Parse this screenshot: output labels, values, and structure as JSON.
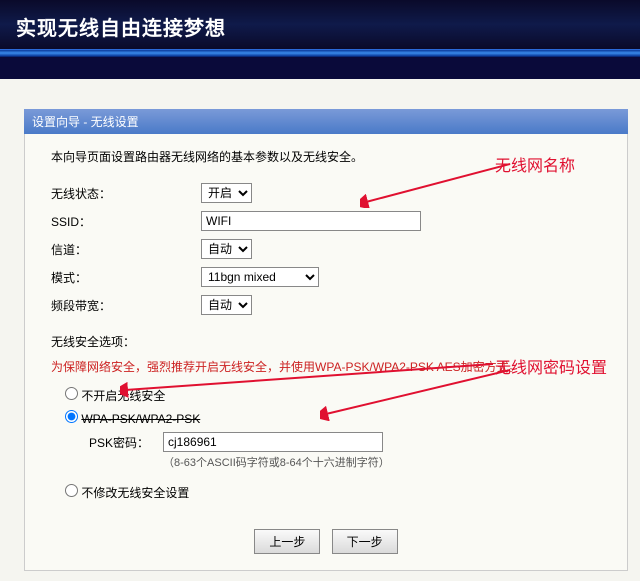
{
  "header": {
    "title": "实现无线自由连接梦想"
  },
  "panel": {
    "title": "设置向导 - 无线设置",
    "instruction": "本向导页面设置路由器无线网络的基本参数以及无线安全。",
    "labels": {
      "wireless_state": "无线状态：",
      "ssid": "SSID：",
      "channel": "信道：",
      "mode": "模式：",
      "bandwidth": "频段带宽：",
      "security_header": "无线安全选项：",
      "security_tip": "为保障网络安全，强烈推荐开启无线安全，并使用WPA-PSK/WPA2-PSK AES加密方式。",
      "psk_label": "PSK密码：",
      "psk_hint": "（8-63个ASCII码字符或8-64个十六进制字符）"
    },
    "values": {
      "wireless_state": "开启",
      "ssid": "WIFI",
      "channel": "自动",
      "mode": "11bgn mixed",
      "bandwidth": "自动",
      "psk": "cj186961"
    },
    "radios": {
      "disable": "不开启无线安全",
      "wpa": "WPA-PSK/WPA2-PSK",
      "nochange": "不修改无线安全设置"
    },
    "buttons": {
      "prev": "上一步",
      "next": "下一步"
    }
  },
  "annotations": {
    "name": "无线网名称",
    "password": "无线网密码设置"
  }
}
